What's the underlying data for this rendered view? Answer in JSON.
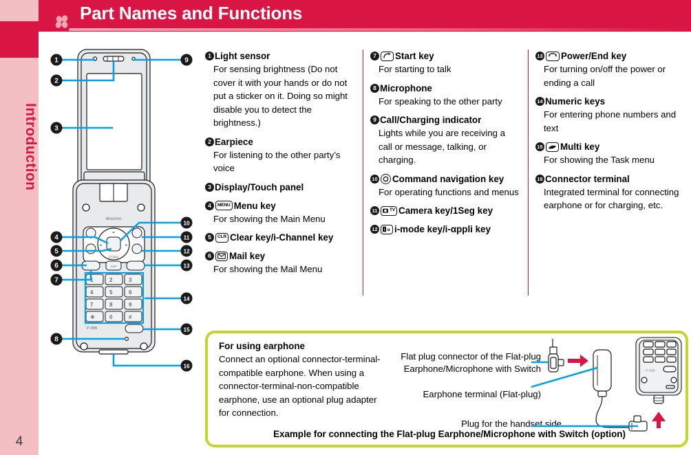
{
  "sidebar": {
    "chapter_label": "Introduction",
    "page_number": "4",
    "accent_color": "#d91543",
    "band_color": "#f4bfc2"
  },
  "header": {
    "title": "Part Names and Functions",
    "background_color": "#d91543",
    "text_color": "#ffffff",
    "decor_icon": "clover-icon"
  },
  "diagram": {
    "name": "mobile-phone-front-diagram",
    "brand_text": "docomo",
    "model_text": "P-08B",
    "callout_numbers": [
      "1",
      "2",
      "3",
      "4",
      "5",
      "6",
      "7",
      "8",
      "9",
      "10",
      "11",
      "12",
      "13",
      "14",
      "15",
      "16"
    ],
    "leader_color": "#00a0e9",
    "keypad_labels": [
      [
        "1",
        "2",
        "3"
      ],
      [
        "4",
        "5",
        "6"
      ],
      [
        "7",
        "8",
        "9"
      ],
      [
        "∗",
        "0",
        "#"
      ]
    ]
  },
  "columns": [
    {
      "id": "column-1",
      "entries": [
        {
          "num": "1",
          "icon": null,
          "title": "Light sensor",
          "body": "For sensing brightness (Do not cover it with your hands or do not put a sticker on it. Doing so might disable you to detect the brightness.)"
        },
        {
          "num": "2",
          "icon": null,
          "title": "Earpiece",
          "body": "For listening to the other party’s voice"
        },
        {
          "num": "3",
          "icon": null,
          "title": "Display/Touch panel",
          "body": ""
        },
        {
          "num": "4",
          "icon": "menu-key-icon",
          "icon_text": "MENU",
          "title": "Menu key",
          "body": "For showing the Main Menu"
        },
        {
          "num": "5",
          "icon": "clear-key-icon",
          "icon_text": "CLR",
          "title": "Clear key/i-Channel key",
          "body": ""
        },
        {
          "num": "6",
          "icon": "mail-key-icon",
          "icon_text": "",
          "title": "Mail key",
          "body": "For showing the Mail Menu"
        }
      ]
    },
    {
      "id": "column-2",
      "entries": [
        {
          "num": "7",
          "icon": "start-key-icon",
          "icon_text": "",
          "title": "Start key",
          "body": "For starting to talk"
        },
        {
          "num": "8",
          "icon": null,
          "title": "Microphone",
          "body": "For speaking to the other party"
        },
        {
          "num": "9",
          "icon": null,
          "title": "Call/Charging indicator",
          "body": "Lights while you are receiving a call or message, talking, or charging."
        },
        {
          "num": "10",
          "icon": "command-navigation-key-icon",
          "icon_text": "",
          "title": "Command navigation key",
          "body": "For operating functions and menus"
        },
        {
          "num": "11",
          "icon": "camera-key-icon",
          "icon_text": "TV",
          "title": "Camera key/1Seg key",
          "body": ""
        },
        {
          "num": "12",
          "icon": "i-mode-key-icon",
          "icon_text": "",
          "title": "i-mode key/i-αppli key",
          "body": ""
        }
      ]
    },
    {
      "id": "column-3",
      "entries": [
        {
          "num": "13",
          "icon": "power-end-key-icon",
          "icon_text": "",
          "title": "Power/End key",
          "body": "For turning on/off the power or ending a call"
        },
        {
          "num": "14",
          "icon": null,
          "title": "Numeric keys",
          "body": "For entering phone numbers and text"
        },
        {
          "num": "15",
          "icon": "multi-key-icon",
          "icon_text": "",
          "title": "Multi key",
          "body": "For showing the Task menu"
        },
        {
          "num": "16",
          "icon": null,
          "title": "Connector terminal",
          "body": "Integrated terminal for connecting earphone or for charging, etc."
        }
      ]
    }
  ],
  "earphone_box": {
    "border_color": "#c4d62e",
    "title": "For using earphone",
    "body": "Connect an optional connector-terminal-compatible earphone. When using a connector-terminal-non-compatible earphone, use an optional plug adapter for connection.",
    "label_flat_plug": "Flat plug connector of the Flat-plug Earphone/Microphone with Switch",
    "label_earphone_terminal": "Earphone terminal (Flat-plug)",
    "label_handset_plug": "Plug for the handset side",
    "caption": "Example for connecting the Flat-plug Earphone/Microphone with Switch (option)",
    "arrow_color": "#d91543",
    "leader_color": "#00a0e9"
  }
}
